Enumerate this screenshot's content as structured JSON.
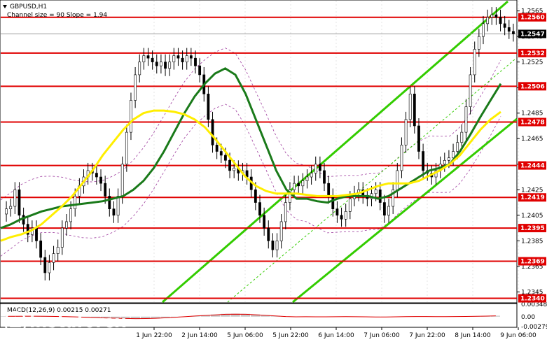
{
  "window": {
    "symbol_label": "GBPUSD,H1",
    "channel_label": "Channel size = 90 Slope = 1.94",
    "collapse_icon": "triangle-down-icon"
  },
  "watermark": {
    "brand": "instaforex",
    "tagline": "Instant Forex Trading"
  },
  "colors": {
    "level_line": "#e00000",
    "ma_green": "#1a7a1a",
    "ma_yellow": "#ffee00",
    "channel": "#33cc00",
    "envelope": "#a040a0",
    "macd_hist": "#c8c8c8",
    "macd_signal": "#e00000"
  },
  "chart_data": [
    {
      "type": "candlestick",
      "symbol": "GBPUSD",
      "timeframe": "H1",
      "y_ticks": [
        "1.2565",
        "1.2545",
        "1.2525",
        "1.2505",
        "1.2485",
        "1.2465",
        "1.2445",
        "1.2425",
        "1.2405",
        "1.2385",
        "1.2365",
        "1.2345"
      ],
      "x_ticks": [
        "1 Jun 22:00",
        "2 Jun 14:00",
        "5 Jun 06:00",
        "5 Jun 22:00",
        "6 Jun 14:00",
        "7 Jun 06:00",
        "7 Jun 22:00",
        "8 Jun 14:00",
        "9 Jun 06:00"
      ],
      "ylim": [
        1.2337,
        1.2573
      ],
      "current_price": "1.2547",
      "levels": [
        "1.2560",
        "1.2532",
        "1.2506",
        "1.2478",
        "1.2444",
        "1.2419",
        "1.2395",
        "1.2369",
        "1.2340"
      ],
      "closes": [
        1.241,
        1.2412,
        1.2425,
        1.2405,
        1.2398,
        1.239,
        1.2395,
        1.2385,
        1.2372,
        1.236,
        1.2368,
        1.2375,
        1.238,
        1.2395,
        1.24,
        1.241,
        1.242,
        1.2428,
        1.2435,
        1.244,
        1.2438,
        1.2435,
        1.243,
        1.242,
        1.241,
        1.2405,
        1.242,
        1.2445,
        1.247,
        1.2495,
        1.2515,
        1.2525,
        1.253,
        1.2528,
        1.2525,
        1.2522,
        1.2525,
        1.252,
        1.2525,
        1.253,
        1.2528,
        1.2525,
        1.253,
        1.2528,
        1.2522,
        1.2515,
        1.25,
        1.248,
        1.246,
        1.2455,
        1.2452,
        1.2448,
        1.244,
        1.2442,
        1.2438,
        1.244,
        1.2435,
        1.2425,
        1.2415,
        1.2405,
        1.2395,
        1.2385,
        1.2378,
        1.2385,
        1.24,
        1.2415,
        1.2425,
        1.243,
        1.2428,
        1.2432,
        1.2435,
        1.2438,
        1.2445,
        1.244,
        1.243,
        1.242,
        1.241,
        1.2405,
        1.2402,
        1.2408,
        1.2418,
        1.2422,
        1.2425,
        1.242,
        1.2418,
        1.2422,
        1.2425,
        1.2415,
        1.2405,
        1.2412,
        1.2425,
        1.244,
        1.246,
        1.248,
        1.25,
        1.2475,
        1.2455,
        1.244,
        1.2438,
        1.2435,
        1.244,
        1.2445,
        1.2448,
        1.245,
        1.2455,
        1.2462,
        1.247,
        1.249,
        1.2515,
        1.2535,
        1.2545,
        1.2555,
        1.256,
        1.2562,
        1.256,
        1.2555,
        1.2552,
        1.2549,
        1.2547
      ],
      "moving_averages": [
        {
          "color": "green",
          "values": [
            1.2395,
            1.2398,
            1.2402,
            1.2405,
            1.2408,
            1.241,
            1.2412,
            1.2413,
            1.2414,
            1.2415,
            1.2416,
            1.2418,
            1.242,
            1.2425,
            1.2432,
            1.2442,
            1.2455,
            1.247,
            1.2485,
            1.2498,
            1.2508,
            1.2516,
            1.252,
            1.2515,
            1.25,
            1.248,
            1.246,
            1.244,
            1.2425,
            1.2418,
            1.2418,
            1.2416,
            1.2415,
            1.2418,
            1.242,
            1.242,
            1.242,
            1.2418,
            1.242,
            1.2425,
            1.243,
            1.2435,
            1.244,
            1.2442,
            1.2445,
            1.2455,
            1.2468,
            1.2482,
            1.2495,
            1.2508
          ]
        },
        {
          "color": "yellow",
          "values": [
            1.2385,
            1.2388,
            1.239,
            1.2393,
            1.2398,
            1.2405,
            1.2412,
            1.242,
            1.243,
            1.244,
            1.2452,
            1.2462,
            1.2472,
            1.248,
            1.2485,
            1.2487,
            1.2487,
            1.2486,
            1.2484,
            1.248,
            1.2474,
            1.2465,
            1.2455,
            1.2445,
            1.2435,
            1.2428,
            1.2424,
            1.2422,
            1.2422,
            1.2422,
            1.2421,
            1.242,
            1.242,
            1.242,
            1.2421,
            1.2422,
            1.2425,
            1.2428,
            1.243,
            1.243,
            1.243,
            1.2432,
            1.2436,
            1.244,
            1.2445,
            1.2452,
            1.2462,
            1.2472,
            1.248,
            1.2486
          ]
        }
      ]
    },
    {
      "type": "histogram",
      "title": "MACD(12,26,9) 0.00215 0.00271",
      "y_ticks": [
        "0.00348",
        "0.00",
        "-0.00279"
      ],
      "ylim": [
        -0.00279,
        0.00348
      ]
    }
  ]
}
